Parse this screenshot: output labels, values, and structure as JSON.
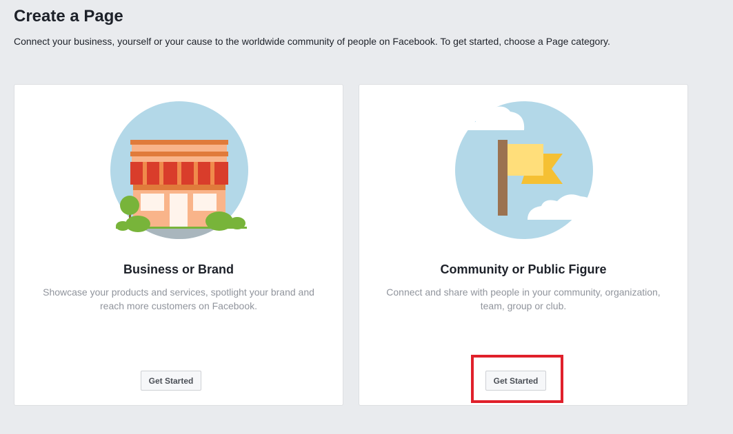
{
  "header": {
    "title": "Create a Page",
    "subtitle": "Connect your business, yourself or your cause to the worldwide community of people on Facebook. To get started, choose a Page category."
  },
  "cards": [
    {
      "title": "Business or Brand",
      "description": "Showcase your products and services, spotlight your brand and reach more customers on Facebook.",
      "button_label": "Get Started",
      "icon": "storefront-illustration"
    },
    {
      "title": "Community or Public Figure",
      "description": "Connect and share with people in your community, organization, team, group or club.",
      "button_label": "Get Started",
      "icon": "flag-illustration"
    }
  ],
  "colors": {
    "background": "#e9ebee",
    "card": "#ffffff",
    "illustration_circle": "#b3d8e8",
    "highlight": "#e0202b"
  }
}
